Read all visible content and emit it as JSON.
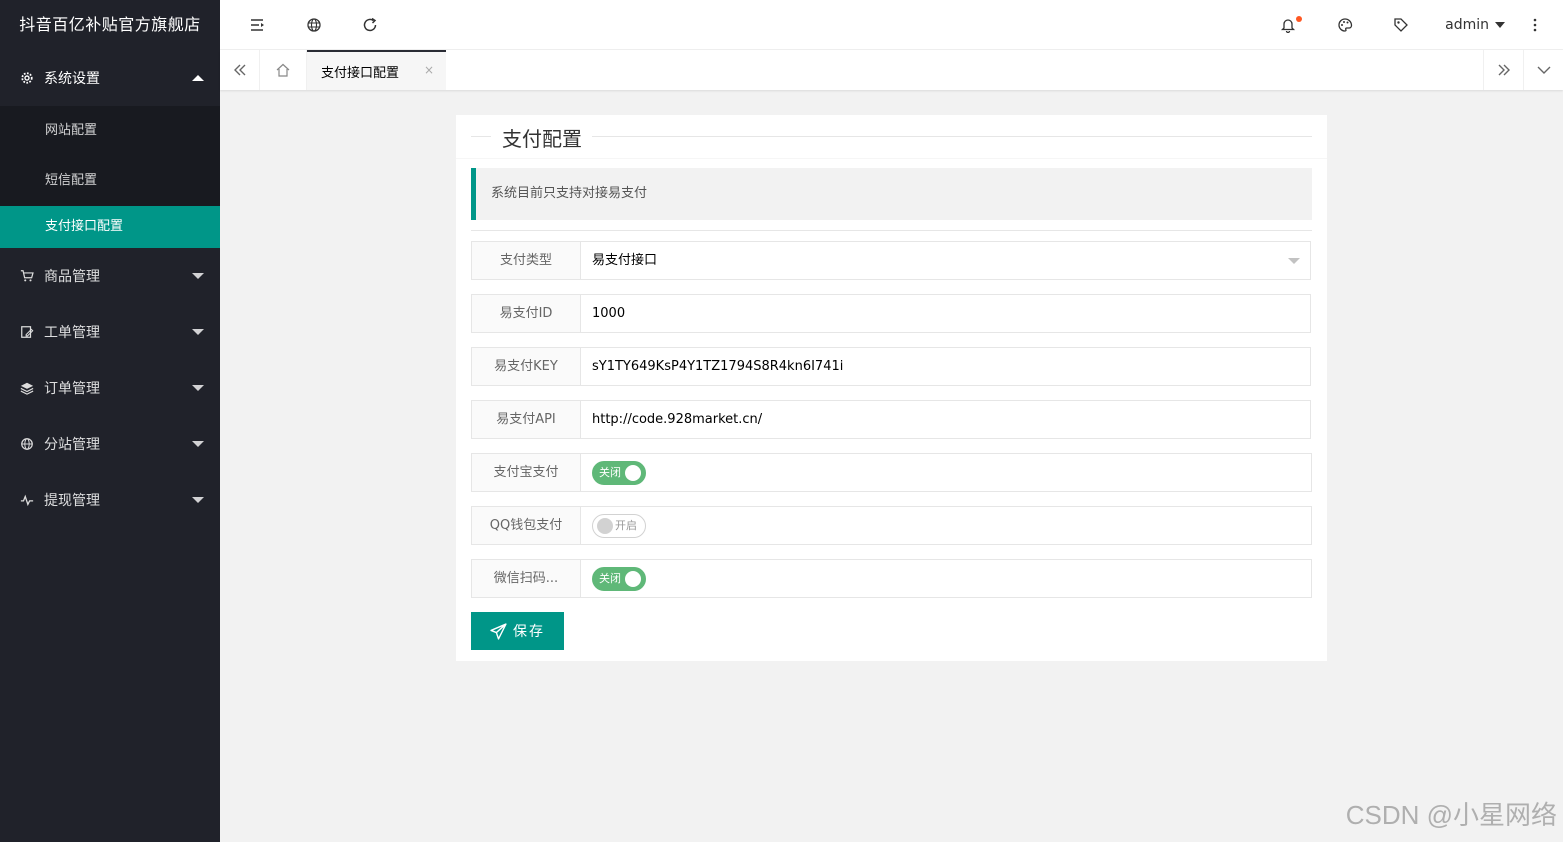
{
  "app": {
    "logo": "抖音百亿补贴官方旗舰店"
  },
  "sidebar": {
    "system": {
      "label": "系统设置",
      "icon": "gear-icon"
    },
    "sub_items": [
      "网站配置",
      "短信配置",
      "支付接口配置"
    ],
    "items": [
      {
        "label": "商品管理",
        "icon": "cart-icon"
      },
      {
        "label": "工单管理",
        "icon": "edit-doc-icon"
      },
      {
        "label": "订单管理",
        "icon": "layers-icon"
      },
      {
        "label": "分站管理",
        "icon": "globe-icon"
      },
      {
        "label": "提现管理",
        "icon": "pulse-icon"
      }
    ]
  },
  "header": {
    "user": "admin"
  },
  "tabs": {
    "active": "支付接口配置",
    "close": "×"
  },
  "card": {
    "title": "支付配置",
    "notice": "系统目前只支持对接易支付",
    "fields": [
      {
        "label": "支付类型",
        "value": "易支付接口"
      },
      {
        "label": "易支付ID",
        "value": "1000"
      },
      {
        "label": "易支付KEY",
        "value": "sY1TY649KsP4Y1TZ1794S8R4kn6I741i"
      },
      {
        "label": "易支付API",
        "value": "http://code.928market.cn/"
      }
    ],
    "switches": [
      {
        "label": "支付宝支付",
        "text": "关闭"
      },
      {
        "label": "QQ钱包支付",
        "text": "开启"
      },
      {
        "label": "微信扫码...",
        "text": "关闭"
      }
    ],
    "save": "保存"
  },
  "watermark": "CSDN @小星网络",
  "colors": {
    "accent": "#009688",
    "sidebar_bg": "#20222a",
    "switch_on": "#5fb878",
    "badge": "#ff5722"
  }
}
